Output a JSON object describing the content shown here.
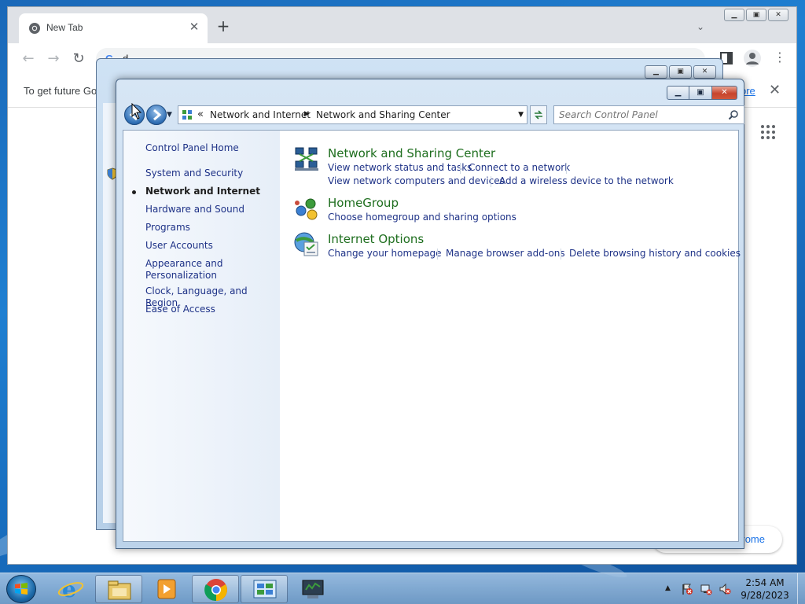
{
  "chrome": {
    "tab_title": "New Tab",
    "tab_close": "✕",
    "new_tab": "+",
    "tab_search": "⌄",
    "omnibox_text": "d",
    "omnibox_g": "G",
    "infobar_text": "To get future Go",
    "infobar_link": "ore",
    "infobar_close": "✕",
    "customize_label": "rome",
    "back": "←",
    "forward": "→",
    "reload": "↻",
    "menu": "⋮"
  },
  "control_panel": {
    "address": {
      "crumb_prefix": "«",
      "crumbs": [
        "Network and Internet",
        "Network and Sharing Center"
      ],
      "separator": "▶",
      "dropdown": "▼"
    },
    "search_placeholder": "Search Control Panel",
    "left_nav": {
      "home": "Control Panel Home",
      "items": [
        "System and Security",
        "Network and Internet",
        "Hardware and Sound",
        "Programs",
        "User Accounts",
        "Appearance and",
        "Personalization",
        "Clock, Language, and Region",
        "Ease of Access"
      ]
    },
    "categories": [
      {
        "title": "Network and Sharing Center",
        "icon": "network-icon",
        "links": [
          "View network status and tasks",
          "Connect to a network",
          "View network computers and devices",
          "Add a wireless device to the network"
        ]
      },
      {
        "title": "HomeGroup",
        "icon": "homegroup-icon",
        "links": [
          "Choose homegroup and sharing options"
        ]
      },
      {
        "title": "Internet Options",
        "icon": "internet-options-icon",
        "links": [
          "Change your homepage",
          "Manage browser add-ons",
          "Delete browsing history and cookies"
        ]
      }
    ]
  },
  "taskbar": {
    "pinned": [
      "internet-explorer-icon",
      "file-explorer-icon",
      "media-player-icon",
      "chrome-icon",
      "control-panel-icon",
      "remote-desktop-icon"
    ],
    "clock_time": "2:54 AM",
    "clock_date": "9/28/2023",
    "tray_arrow": "▲"
  },
  "colors": {
    "category_title": "#1e6e1e",
    "link": "#1e3287",
    "chrome_link": "#1a73e8"
  }
}
